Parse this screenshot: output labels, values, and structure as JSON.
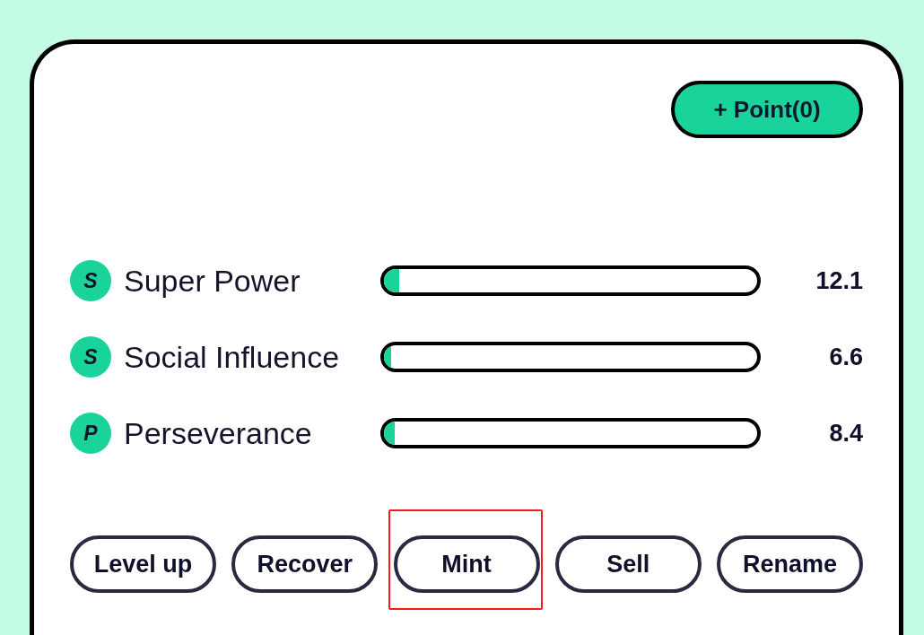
{
  "header": {
    "point_button": "+ Point(0)"
  },
  "stats": [
    {
      "badge": "S",
      "name": "Super Power",
      "level": 0.04,
      "value": "12.1"
    },
    {
      "badge": "S",
      "name": "Social Influence",
      "level": 0.02,
      "value": "6.6"
    },
    {
      "badge": "P",
      "name": "Perseverance",
      "level": 0.03,
      "value": "8.4"
    }
  ],
  "actions": [
    {
      "label": "Level up",
      "highlighted": false
    },
    {
      "label": "Recover",
      "highlighted": false
    },
    {
      "label": "Mint",
      "highlighted": true
    },
    {
      "label": "Sell",
      "highlighted": false
    },
    {
      "label": "Rename",
      "highlighted": false
    }
  ]
}
